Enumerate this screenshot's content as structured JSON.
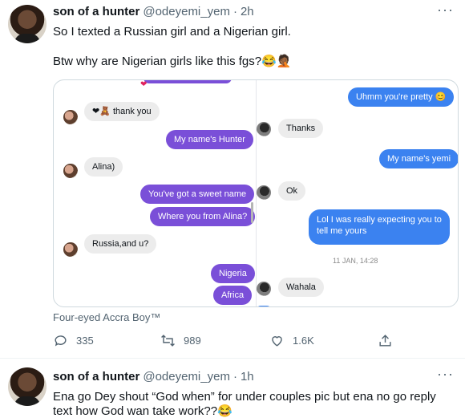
{
  "tweet1": {
    "author_name": "son of a hunter",
    "handle": "@odeyemi_yem",
    "separator": "·",
    "time": "2h",
    "more_label": "···",
    "text_line1": "So I texted a Russian girl and a Nigerian girl.",
    "text_line2": "Btw why are Nigerian girls like this fgs?😂🤦🏾",
    "media_credit": "Four-eyed Accra Boy™",
    "left_chat": {
      "top_heart": "❤",
      "messages": [
        {
          "from": "them",
          "text": "❤🧸 thank you"
        },
        {
          "from": "me",
          "text": "My name's Hunter"
        },
        {
          "from": "them",
          "text": "Alina)"
        },
        {
          "from": "me",
          "text": "You've got a sweet name"
        },
        {
          "from": "me",
          "text": "Where you from Alina?"
        },
        {
          "from": "them",
          "text": "Russia,and u?"
        },
        {
          "from": "me",
          "text": "Nigeria"
        },
        {
          "from": "me",
          "text": "Africa"
        }
      ]
    },
    "right_chat": {
      "messages": [
        {
          "from": "me",
          "text": "Uhmm you're pretty 😊"
        },
        {
          "from": "them",
          "text": "Thanks"
        },
        {
          "from": "me",
          "text": "My name's yemi"
        },
        {
          "from": "them",
          "text": "Ok"
        },
        {
          "from": "me",
          "text": "Lol I was really expecting you to"
        },
        {
          "from": "me",
          "text": "tell me yours"
        },
        {
          "from": "them",
          "text": "Wahala"
        }
      ],
      "timestamp": "11 JAN, 14:28"
    },
    "actions": {
      "reply_count": "335",
      "retweet_count": "989",
      "like_count": "1.6K"
    }
  },
  "tweet2": {
    "author_name": "son of a hunter",
    "handle": "@odeyemi_yem",
    "separator": "·",
    "time": "1h",
    "more_label": "···",
    "text_line1": "Ena go Dey shout “God when” for under couples pic but ena no go reply",
    "text_line2": "text how God wan take work??😂"
  },
  "icons": {
    "reply": "reply-icon",
    "retweet": "retweet-icon",
    "like": "heart-icon",
    "share": "share-icon"
  },
  "colors": {
    "left_outgoing_bubble": "#7a4fd8",
    "right_outgoing_bubble": "#3b82f0",
    "incoming_bubble": "#ececec",
    "muted_text": "#536471"
  }
}
